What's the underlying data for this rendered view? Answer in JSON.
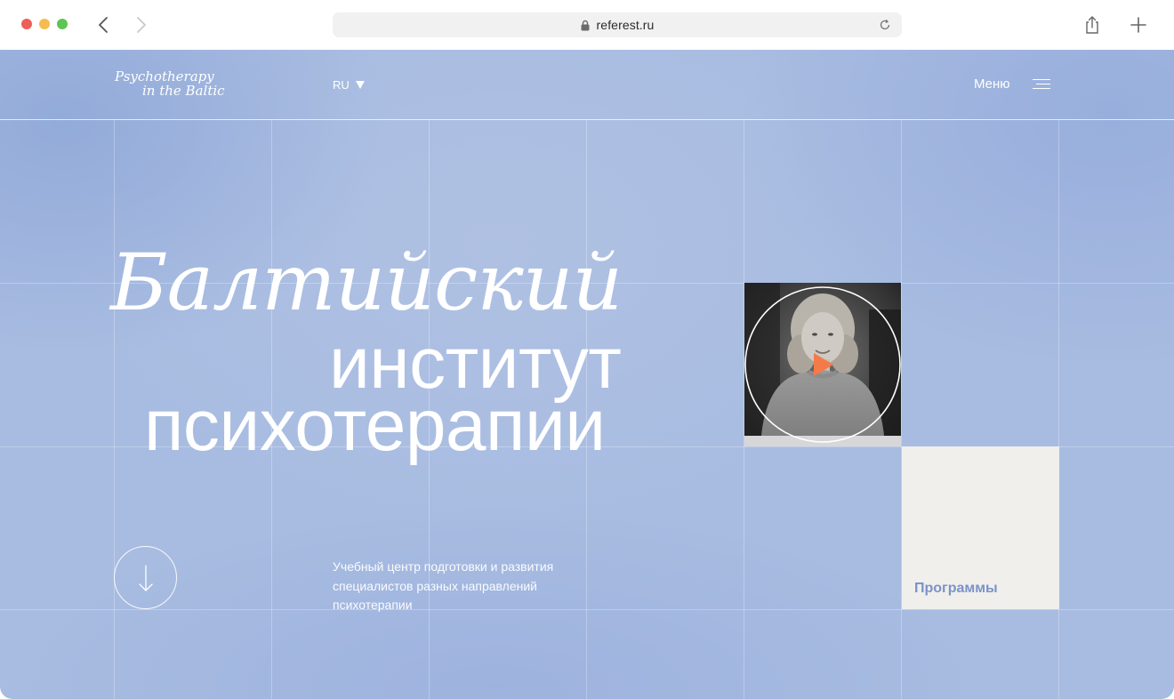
{
  "browser": {
    "url": "referest.ru",
    "icons": [
      "back-icon",
      "forward-icon",
      "lock-icon",
      "reload-icon",
      "share-icon",
      "plus-icon"
    ]
  },
  "header": {
    "logo_line1": "Psychotherapy",
    "logo_line2": "in the Baltic",
    "language": "RU",
    "menu_label": "Меню"
  },
  "hero": {
    "title_italic": "Балтийский",
    "title_line2": "институт",
    "title_line3": "психотерапии",
    "description": "Учебный центр подготовки и развития специалистов разных направлений психотерапии"
  },
  "video": {
    "play_color": "#f47a4a"
  },
  "programs": {
    "label": "Программы"
  },
  "colors": {
    "background": "#a8bce1",
    "text": "#ffffff",
    "programs_card": "#f0efec",
    "programs_text": "#7a93c8"
  }
}
